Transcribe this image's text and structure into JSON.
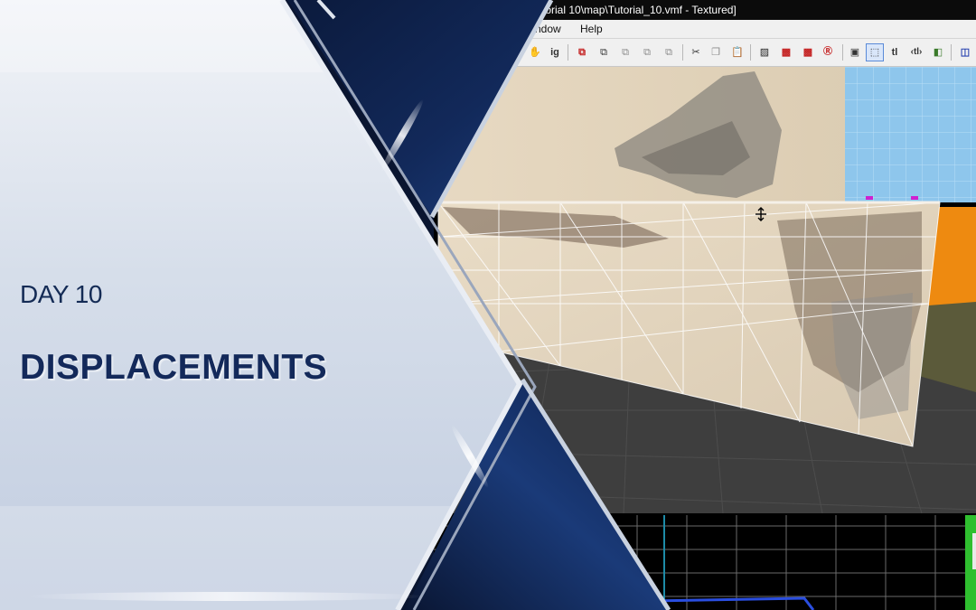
{
  "editor": {
    "window_title": "torial 10\\map\\Tutorial_10.vmf - Textured]",
    "menu": [
      {
        "label": "ndow"
      },
      {
        "label": "Help"
      }
    ],
    "toolbar": {
      "ignore_group_label": "ig",
      "texture_lock_label": "tl",
      "texture_scale_lock_label": "‹tl›"
    }
  },
  "title_card": {
    "day_label": "DAY 10",
    "title": "DISPLACEMENTS"
  },
  "colors": {
    "title_text": "#13295a",
    "editor_menu_bg": "#f0f0f0",
    "wall_texture": "#e2d3bb",
    "floor_dark": "#3e3e3e",
    "orange_brush": "#ee8a10",
    "sky_blue": "#8ec6ec",
    "grid_2d": "#6a6a6a"
  }
}
